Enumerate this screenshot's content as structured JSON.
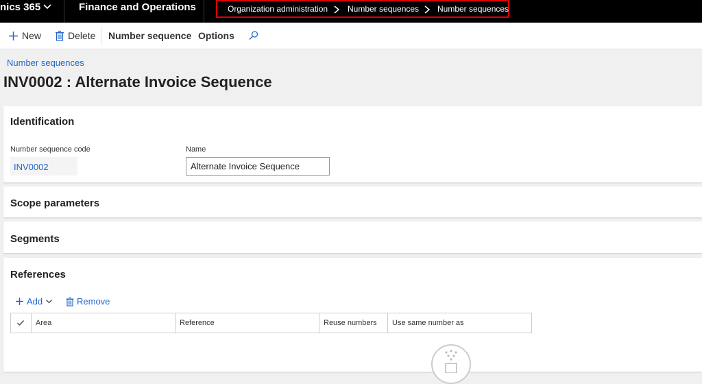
{
  "topbar": {
    "app_name": "nics 365",
    "product": "Finance and Operations",
    "breadcrumb": [
      "Organization administration",
      "Number sequences",
      "Number sequences"
    ]
  },
  "actions": {
    "new_label": "New",
    "delete_label": "Delete",
    "number_sequence_label": "Number sequence",
    "options_label": "Options"
  },
  "page": {
    "crumb_link": "Number sequences",
    "title": "INV0002 : Alternate Invoice Sequence"
  },
  "identification": {
    "title": "Identification",
    "code_label": "Number sequence code",
    "code_value": "INV0002",
    "name_label": "Name",
    "name_value": "Alternate Invoice Sequence"
  },
  "scope": {
    "title": "Scope parameters"
  },
  "segments": {
    "title": "Segments"
  },
  "references": {
    "title": "References",
    "add_label": "Add",
    "remove_label": "Remove",
    "columns": [
      "Area",
      "Reference",
      "Reuse numbers",
      "Use same number as"
    ]
  },
  "colors": {
    "accent": "#2266cc",
    "highlight_border": "#e00000"
  }
}
